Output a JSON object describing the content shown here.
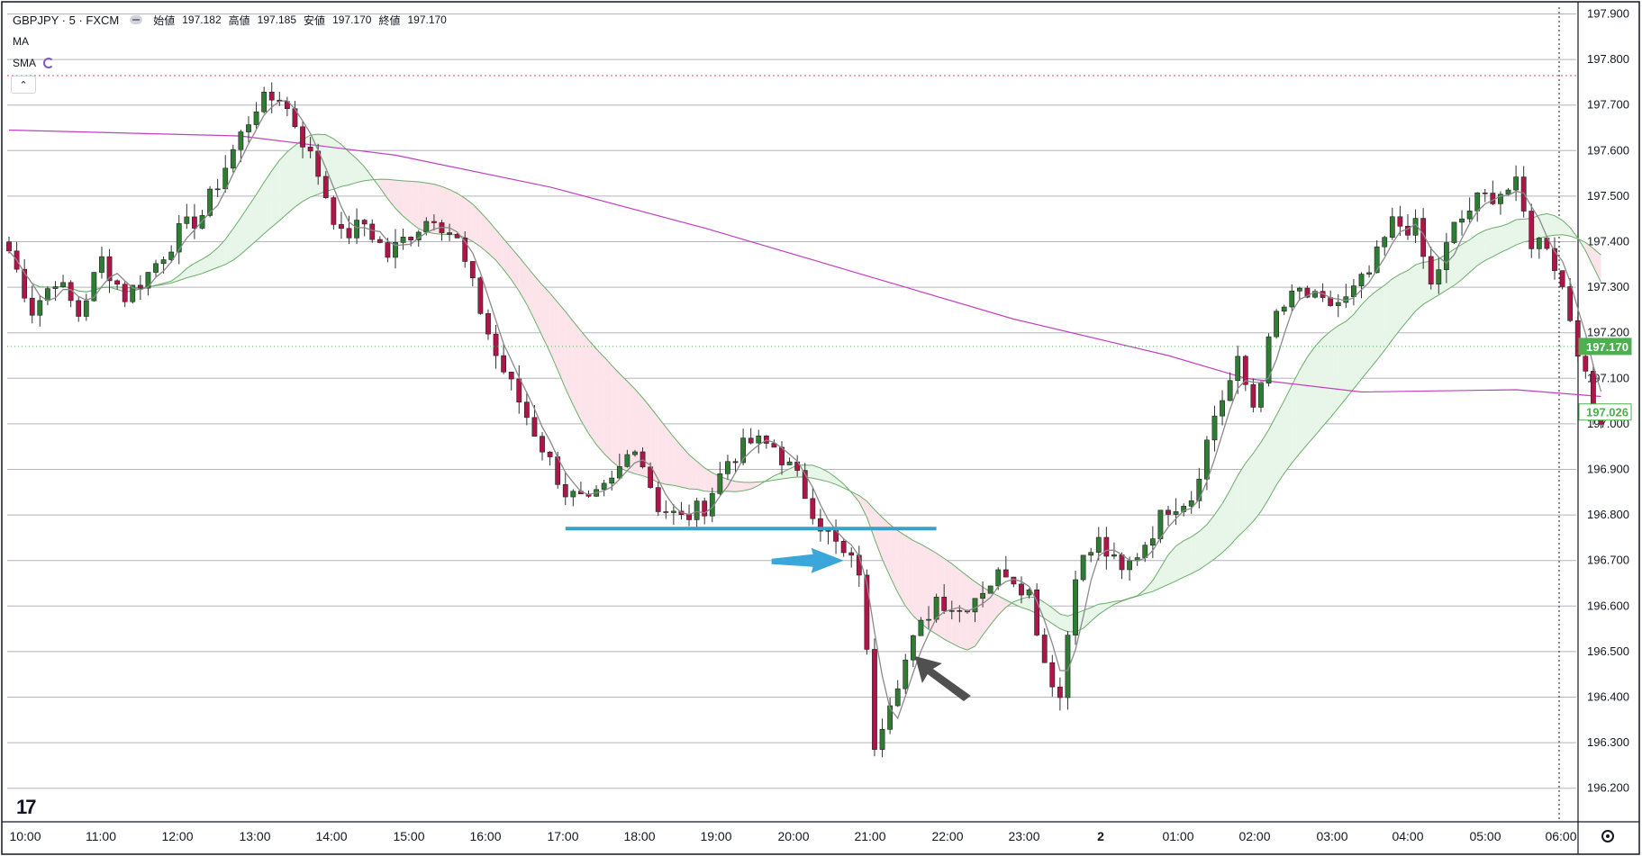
{
  "header": {
    "symbol": "GBPJPY · 5 · FXCM",
    "open_label": "始値",
    "open": "197.182",
    "high_label": "高値",
    "high": "197.185",
    "low_label": "安値",
    "low": "197.170",
    "close_label": "終値",
    "close": "197.170",
    "ma_label": "MA",
    "sma_label": "SMA"
  },
  "price_badges": {
    "current": "197.170",
    "current_color": "#4caf50",
    "ma": "197.026",
    "ma_color": "#4caf50"
  },
  "colors": {
    "bull": "#2e7d32",
    "bear": "#b0154a",
    "fast_ma": "#8a8a8a",
    "cloud_up": "#e8f5e9",
    "cloud_down": "#fde4ea",
    "cloud_line": "#6aae6a",
    "long_ma": "#c040c0",
    "support_line": "#3a9fc9",
    "arrow_blue": "#3aa6d9",
    "arrow_gray": "#505050"
  },
  "chart_data": {
    "type": "candlestick",
    "instrument": "GBPJPY · 5 · FXCM",
    "y_axis": {
      "ylim": [
        196.14,
        197.92
      ],
      "ticks": [
        "197.900",
        "197.800",
        "197.700",
        "197.600",
        "197.500",
        "197.400",
        "197.300",
        "197.200",
        "197.100",
        "197.000",
        "196.900",
        "196.800",
        "196.700",
        "196.600",
        "196.500",
        "196.400",
        "196.300",
        "196.200"
      ]
    },
    "x_axis": {
      "ticks": [
        "10:00",
        "11:00",
        "12:00",
        "13:00",
        "14:00",
        "15:00",
        "16:00",
        "17:00",
        "18:00",
        "19:00",
        "20:00",
        "21:00",
        "22:00",
        "23:00",
        "2",
        "01:00",
        "02:00",
        "03:00",
        "04:00",
        "05:00",
        "06:00"
      ]
    },
    "anchors": [
      {
        "t": 0,
        "p": 197.38
      },
      {
        "t": 3,
        "p": 197.25
      },
      {
        "t": 6,
        "p": 197.32
      },
      {
        "t": 9,
        "p": 197.24
      },
      {
        "t": 12,
        "p": 197.36
      },
      {
        "t": 15,
        "p": 197.28
      },
      {
        "t": 18,
        "p": 197.33
      },
      {
        "t": 22,
        "p": 197.42
      },
      {
        "t": 25,
        "p": 197.46
      },
      {
        "t": 29,
        "p": 197.6
      },
      {
        "t": 32,
        "p": 197.7
      },
      {
        "t": 35,
        "p": 197.72
      },
      {
        "t": 37,
        "p": 197.66
      },
      {
        "t": 40,
        "p": 197.55
      },
      {
        "t": 43,
        "p": 197.41
      },
      {
        "t": 46,
        "p": 197.44
      },
      {
        "t": 49,
        "p": 197.37
      },
      {
        "t": 52,
        "p": 197.42
      },
      {
        "t": 55,
        "p": 197.46
      },
      {
        "t": 58,
        "p": 197.4
      },
      {
        "t": 60,
        "p": 197.3
      },
      {
        "t": 63,
        "p": 197.15
      },
      {
        "t": 66,
        "p": 197.05
      },
      {
        "t": 69,
        "p": 196.95
      },
      {
        "t": 72,
        "p": 196.85
      },
      {
        "t": 75,
        "p": 196.82
      },
      {
        "t": 78,
        "p": 196.87
      },
      {
        "t": 81,
        "p": 196.96
      },
      {
        "t": 84,
        "p": 196.82
      },
      {
        "t": 87,
        "p": 196.79
      },
      {
        "t": 90,
        "p": 196.82
      },
      {
        "t": 93,
        "p": 196.92
      },
      {
        "t": 96,
        "p": 196.96
      },
      {
        "t": 99,
        "p": 196.95
      },
      {
        "t": 102,
        "p": 196.88
      },
      {
        "t": 105,
        "p": 196.78
      },
      {
        "t": 108,
        "p": 196.71
      },
      {
        "t": 110,
        "p": 196.68
      },
      {
        "t": 112,
        "p": 196.3
      },
      {
        "t": 114,
        "p": 196.4
      },
      {
        "t": 117,
        "p": 196.52
      },
      {
        "t": 120,
        "p": 196.62
      },
      {
        "t": 123,
        "p": 196.59
      },
      {
        "t": 126,
        "p": 196.64
      },
      {
        "t": 129,
        "p": 196.68
      },
      {
        "t": 132,
        "p": 196.63
      },
      {
        "t": 134,
        "p": 196.48
      },
      {
        "t": 136,
        "p": 196.4
      },
      {
        "t": 138,
        "p": 196.68
      },
      {
        "t": 141,
        "p": 196.74
      },
      {
        "t": 144,
        "p": 196.67
      },
      {
        "t": 147,
        "p": 196.74
      },
      {
        "t": 150,
        "p": 196.82
      },
      {
        "t": 153,
        "p": 196.84
      },
      {
        "t": 156,
        "p": 197.02
      },
      {
        "t": 159,
        "p": 197.13
      },
      {
        "t": 161,
        "p": 197.04
      },
      {
        "t": 164,
        "p": 197.24
      },
      {
        "t": 167,
        "p": 197.29
      },
      {
        "t": 170,
        "p": 197.26
      },
      {
        "t": 173,
        "p": 197.27
      },
      {
        "t": 176,
        "p": 197.33
      },
      {
        "t": 179,
        "p": 197.44
      },
      {
        "t": 182,
        "p": 197.43
      },
      {
        "t": 184,
        "p": 197.3
      },
      {
        "t": 187,
        "p": 197.43
      },
      {
        "t": 190,
        "p": 197.49
      },
      {
        "t": 193,
        "p": 197.51
      },
      {
        "t": 195,
        "p": 197.52
      },
      {
        "t": 197,
        "p": 197.4
      },
      {
        "t": 199,
        "p": 197.4
      },
      {
        "t": 201,
        "p": 197.3
      },
      {
        "t": 203,
        "p": 197.17
      },
      {
        "t": 205,
        "p": 197.02
      },
      {
        "t": 206,
        "p": 197.02
      }
    ],
    "wick_extremes": {
      "high": 197.74,
      "low": 196.27
    },
    "series": [
      {
        "type": "candlestick",
        "bars": 207
      },
      {
        "type": "sma-fast"
      },
      {
        "type": "sma-band"
      },
      {
        "type": "sma-long",
        "points": [
          [
            0,
            197.645
          ],
          [
            30,
            197.632
          ],
          [
            50,
            197.59
          ],
          [
            70,
            197.52
          ],
          [
            90,
            197.43
          ],
          [
            110,
            197.33
          ],
          [
            130,
            197.23
          ],
          [
            150,
            197.15
          ],
          [
            160,
            197.1
          ],
          [
            175,
            197.07
          ],
          [
            195,
            197.075
          ],
          [
            206,
            197.06
          ]
        ]
      }
    ],
    "annotations": [
      {
        "type": "horizontal-line",
        "price": 196.77,
        "from_bar": 72,
        "to_bar": 120
      },
      {
        "type": "arrow",
        "direction": "right",
        "price": 196.7,
        "at_bar": 108
      },
      {
        "type": "arrow",
        "direction": "up-left",
        "price": 196.49,
        "at_bar": 117
      }
    ]
  }
}
